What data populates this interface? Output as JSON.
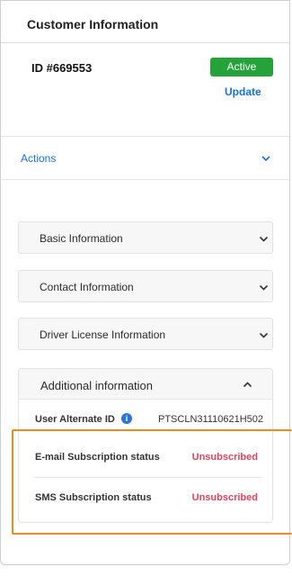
{
  "header": {
    "title": "Customer Information"
  },
  "customer": {
    "id_label": "ID #669553",
    "status": "Active",
    "update_label": "Update"
  },
  "actions": {
    "label": "Actions"
  },
  "sections": [
    {
      "label": "Basic Information"
    },
    {
      "label": "Contact Information"
    },
    {
      "label": "Driver License Information"
    }
  ],
  "additional": {
    "title": "Additional information",
    "rows": [
      {
        "key": "User Alternate ID",
        "value": "PTSCLN31110621H502"
      },
      {
        "key": "E-mail Subscription status",
        "value": "Unsubscribed"
      },
      {
        "key": "SMS Subscription status",
        "value": "Unsubscribed"
      }
    ]
  },
  "colors": {
    "active_green": "#25a23a",
    "link_blue": "#1b6fd8",
    "unsubscribed_red": "#e0445c",
    "highlight_orange": "#ef8a1e"
  }
}
